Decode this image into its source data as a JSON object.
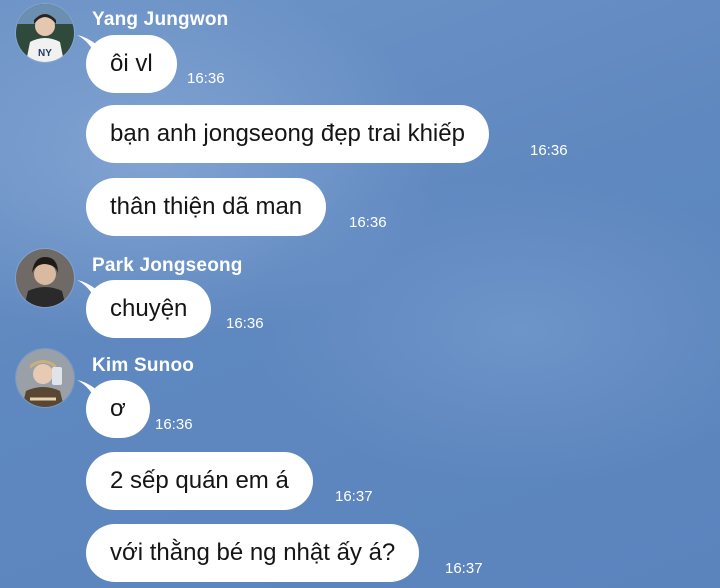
{
  "chat": {
    "groups": [
      {
        "sender": "Yang Jungwon",
        "messages": [
          {
            "text": "ôi vl",
            "time": "16:36"
          },
          {
            "text": "bạn anh jongseong đẹp trai khiếp",
            "time": "16:36"
          },
          {
            "text": "thân thiện dã man",
            "time": "16:36"
          }
        ]
      },
      {
        "sender": "Park Jongseong",
        "messages": [
          {
            "text": "chuyện",
            "time": "16:36"
          }
        ]
      },
      {
        "sender": "Kim Sunoo",
        "messages": [
          {
            "text": "ơ",
            "time": "16:36"
          },
          {
            "text": "2 sếp quán em á",
            "time": "16:37"
          },
          {
            "text": "với thằng bé ng nhật ấy á?",
            "time": "16:37"
          }
        ]
      }
    ]
  },
  "colors": {
    "background": "#5f88c0",
    "bubble": "#ffffff",
    "bubble_text": "#151515",
    "meta_text": "#ffffff"
  }
}
